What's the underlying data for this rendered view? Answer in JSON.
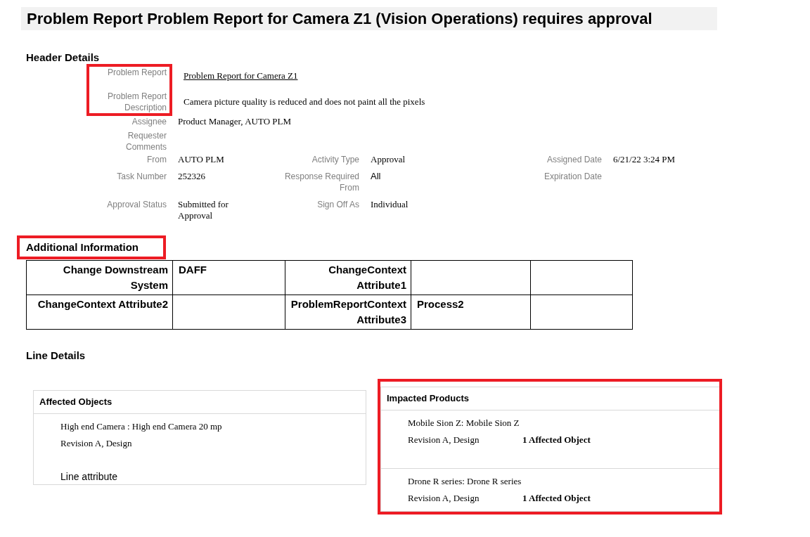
{
  "title": "Problem Report Problem Report for Camera Z1 (Vision Operations) requires approval",
  "header_details": {
    "heading": "Header Details",
    "rows": [
      {
        "highlighted": true,
        "cells": [
          {
            "label": "Problem Report",
            "value": "Problem Report for Camera Z1",
            "kind": "link"
          }
        ]
      },
      {
        "highlighted": true,
        "cells": [
          {
            "label": "Problem Report Description",
            "value": "Camera picture quality is reduced and does not paint all the pixels",
            "kind": "text"
          }
        ]
      },
      {
        "highlighted": false,
        "cells": [
          {
            "label": "Assignee",
            "value": "Product Manager, AUTO PLM",
            "kind": "text"
          }
        ]
      },
      {
        "highlighted": false,
        "cells": [
          {
            "label": "Requester Comments"
          }
        ]
      },
      {
        "highlighted": false,
        "cells": [
          {
            "label": "From",
            "value": "AUTO PLM",
            "kind": "text"
          },
          {
            "label": "Activity Type",
            "value": "Approval",
            "kind": "text"
          },
          {
            "label": "Assigned Date",
            "value": "6/21/22 3:24 PM",
            "kind": "text"
          }
        ]
      },
      {
        "highlighted": false,
        "cells": [
          {
            "label": "Task Number",
            "value": "252326",
            "kind": "text"
          },
          {
            "label": "Response Required From",
            "value": "All",
            "kind": "plain"
          },
          {
            "label": "Expiration Date"
          }
        ]
      },
      {
        "highlighted": false,
        "cells": [
          {
            "label": "Approval Status",
            "value": "Submitted for Approval",
            "kind": "text"
          },
          {
            "label": "Sign Off As",
            "value": "Individual",
            "kind": "text"
          }
        ]
      }
    ]
  },
  "additional_information": {
    "heading": "Additional Information",
    "highlighted": true,
    "rows": [
      [
        {
          "label": "Change Downstream System",
          "value": "DAFF"
        },
        {
          "label": "ChangeContext Attribute1"
        }
      ],
      [
        {
          "label": "ChangeContext Attribute2"
        },
        {
          "label": "ProblemReportContext Attribute3",
          "value": "Process2"
        }
      ]
    ]
  },
  "line_details": {
    "heading": "Line Details",
    "panels": [
      {
        "title": "Affected Objects",
        "highlighted": false,
        "items": [
          {
            "name": "High end Camera : High end Camera  20 mp",
            "revision": "Revision A, Design"
          }
        ],
        "attribute": "Line attribute"
      },
      {
        "title": "Impacted Products",
        "highlighted": true,
        "items": [
          {
            "name": "Mobile Sion Z: Mobile Sion Z",
            "revision": "Revision A, Design",
            "count": "1 Affected Object"
          },
          {
            "name": "Drone R series: Drone R series",
            "revision": "Revision A, Design",
            "count": "1 Affected Object"
          }
        ]
      }
    ]
  }
}
